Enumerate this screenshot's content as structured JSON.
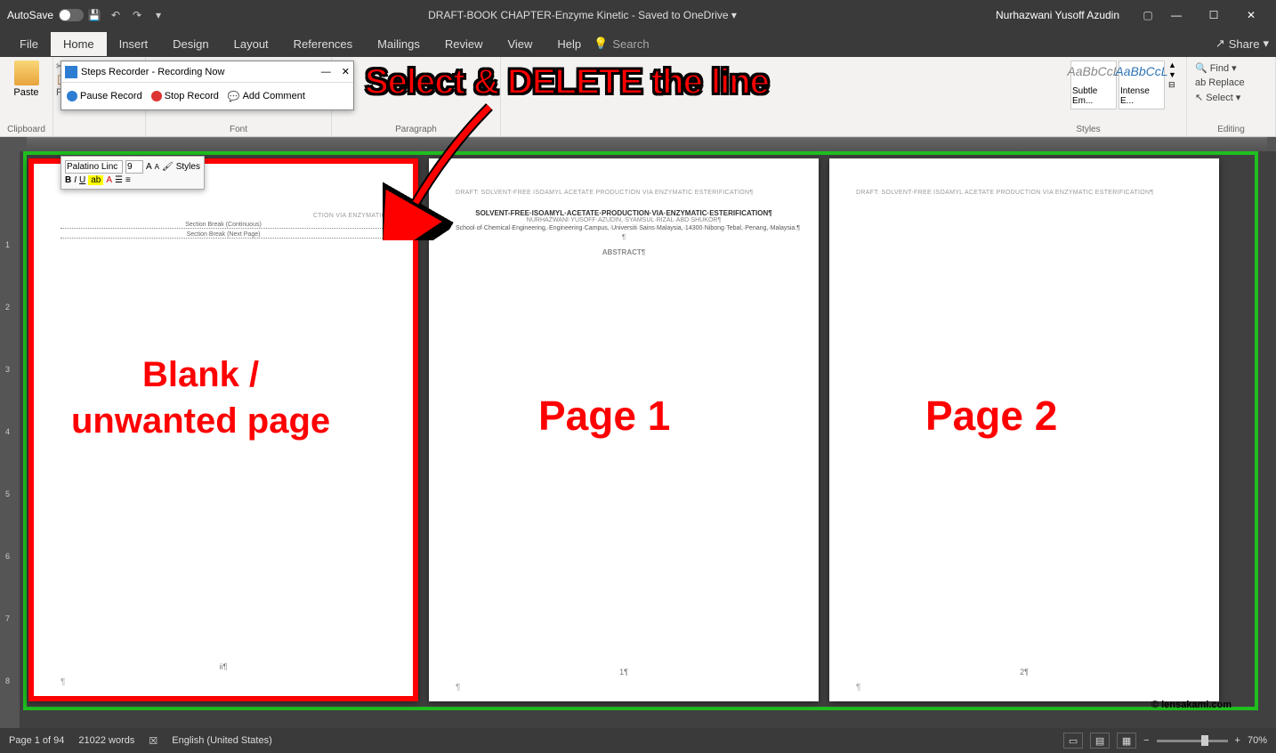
{
  "titleBar": {
    "autosave": "AutoSave",
    "docTitle": "DRAFT-BOOK CHAPTER-Enzyme Kinetic  -  Saved to OneDrive ▾",
    "user": "Nurhazwani Yusoff Azudin"
  },
  "ribbonTabs": {
    "file": "File",
    "home": "Home",
    "insert": "Insert",
    "design": "Design",
    "layout": "Layout",
    "references": "References",
    "mailings": "Mailings",
    "review": "Review",
    "view": "View",
    "help": "Help",
    "search": "Search",
    "share": "Share"
  },
  "ribbon": {
    "paste": "Paste",
    "formatPainter": "Format Painter",
    "clipboardLabel": "Clipboard",
    "fontLabel": "Font",
    "paragraphLabel": "Paragraph",
    "stylesLabel": "Styles",
    "editingLabel": "Editing",
    "find": "Find",
    "replace": "Replace",
    "select": "Select",
    "styles": [
      {
        "preview": "AaBbCcL",
        "name": "Subtle Em..."
      },
      {
        "preview": "AaBbCcL",
        "name": "Intense E..."
      }
    ]
  },
  "stepsRecorder": {
    "title": "Steps Recorder - Recording Now",
    "pause": "Pause Record",
    "stop": "Stop Record",
    "comment": "Add Comment"
  },
  "miniToolbar": {
    "font": "Palatino Linc",
    "size": "9",
    "stylesBtn": "Styles"
  },
  "document": {
    "header": "DRAFT: SOLVENT-FREE ISOAMYL ACETATE PRODUCTION VIA ENZYMATIC ESTERIFICATION¶",
    "sectionBreak1": "Section Break (Continuous)",
    "sectionBreak2": "Section Break (Next Page)",
    "title": "SOLVENT-FREE·ISOAMYL·ACETATE·PRODUCTION·VIA·ENZYMATIC·ESTERIFICATION¶",
    "authors": "NURHAZWANI·YUSOFF·AZUDIN,·SYAMSUL·RIZAL·ABD·SHUKOR¶",
    "affiliation": "School·of·Chemical·Engineering,·Engineering·Campus,·Universiti·Sains·Malaysia,·14300·Nibong·Tebal,·Penang,·Malaysia.¶",
    "abstract": "ABSTRACT¶",
    "pageNum1": "ii¶",
    "pageNum2": "1¶",
    "pageNum3": "2¶"
  },
  "annotations": {
    "main": "Select & DELETE the line",
    "blank": "Blank /\nunwanted page",
    "page1": "Page 1",
    "page2": "Page 2",
    "watermark": "© lensakami.com"
  },
  "statusBar": {
    "page": "Page 1 of 94",
    "words": "21022 words",
    "language": "English (United States)",
    "zoom": "70%"
  },
  "rulerMarks": [
    "1",
    "2",
    "3",
    "4",
    "5",
    "6",
    "7",
    "8"
  ]
}
